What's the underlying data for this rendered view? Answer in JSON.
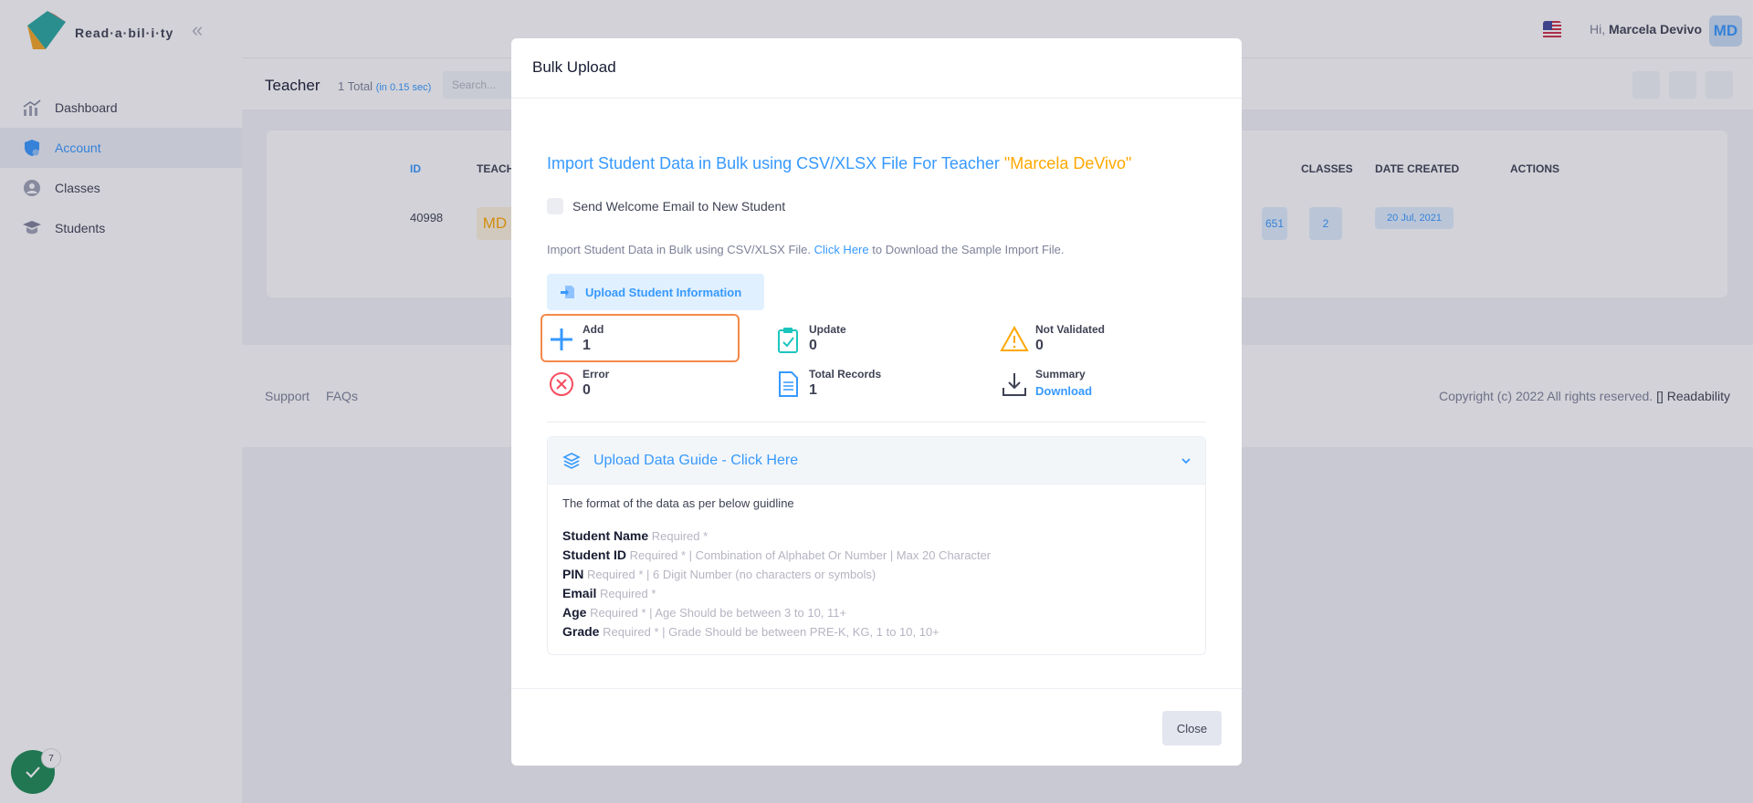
{
  "sidebar": {
    "logo_text": "Read·a·bil·i·ty",
    "items": [
      {
        "label": "Dashboard",
        "icon": "chart-icon"
      },
      {
        "label": "Account",
        "icon": "shield-icon"
      },
      {
        "label": "Classes",
        "icon": "classes-icon"
      },
      {
        "label": "Students",
        "icon": "students-icon"
      }
    ],
    "active_item": "Account"
  },
  "header": {
    "greeting_prefix": "Hi,",
    "user_name": "Marcela Devivo",
    "avatar_initials": "MD"
  },
  "subheader": {
    "title": "Teacher",
    "count": "1 Total",
    "timing": "(in 0.15 sec)",
    "search_placeholder": "Search..."
  },
  "table": {
    "columns": [
      "ID",
      "TEACH",
      "CLASSES",
      "DATE CREATED",
      "ACTIONS"
    ],
    "row": {
      "id": "40998",
      "initials": "MD",
      "books": "651",
      "classes": "2",
      "date_created": "20 Jul, 2021"
    }
  },
  "footer": {
    "links": [
      "Support",
      "FAQs"
    ],
    "copyright": "Copyright (c) 2022 All rights reserved.",
    "brand": "[] Readability"
  },
  "status": {
    "badge_count": "7"
  },
  "modal": {
    "title": "Bulk Upload",
    "import_title": "Import Student Data in Bulk using CSV/XLSX File For Teacher",
    "teacher_name": "\"Marcela DeVivo\"",
    "send_welcome_label": "Send Welcome Email to New Student",
    "import_desc_prefix": "Import Student Data in Bulk using CSV/XLSX File.",
    "click_here": "Click Here",
    "import_desc_suffix": "to Download the Sample Import File.",
    "upload_button": "Upload Student Information",
    "stats": {
      "add": {
        "label": "Add",
        "value": "1"
      },
      "update": {
        "label": "Update",
        "value": "0"
      },
      "not_validated": {
        "label": "Not Validated",
        "value": "0"
      },
      "error": {
        "label": "Error",
        "value": "0"
      },
      "total_records": {
        "label": "Total Records",
        "value": "1"
      },
      "summary": {
        "label": "Summary",
        "link": "Download"
      }
    },
    "guide": {
      "title": "Upload Data Guide - Click Here",
      "intro": "The format of the data as per below guidline",
      "fields": [
        {
          "name": "Student Name",
          "rule": "Required *"
        },
        {
          "name": "Student ID",
          "rule": "Required * | Combination of Alphabet Or Number | Max 20 Character"
        },
        {
          "name": "PIN",
          "rule": "Required * | 6 Digit Number (no characters or symbols)"
        },
        {
          "name": "Email",
          "rule": "Required *"
        },
        {
          "name": "Age",
          "rule": "Required * | Age Should be between 3 to 10, 11+"
        },
        {
          "name": "Grade",
          "rule": "Required * | Grade Should be between PRE-K, KG, 1 to 10, 10+"
        }
      ]
    },
    "close_button": "Close"
  },
  "colors": {
    "primary": "#3699ff",
    "accent": "#ffa800",
    "highlight": "#f5894a",
    "success": "#1c8b52"
  }
}
